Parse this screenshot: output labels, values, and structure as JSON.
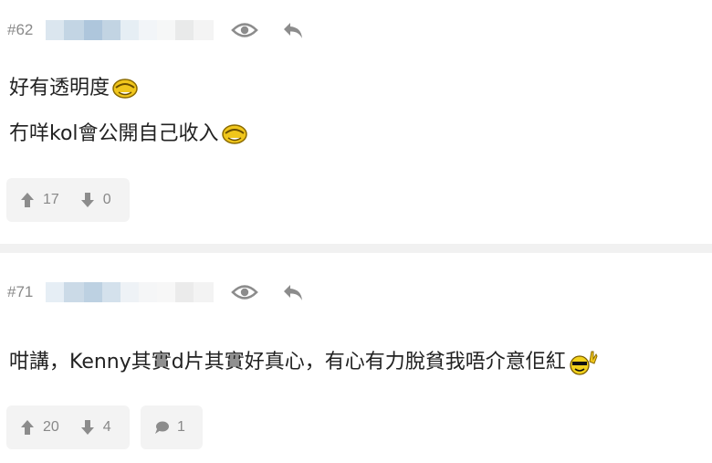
{
  "posts": [
    {
      "number": "#62",
      "lines": [
        "好有透明度",
        "冇咩kol會公開自己收入"
      ],
      "upvotes": "17",
      "downvotes": "0"
    },
    {
      "number": "#71",
      "lines": [
        "咁講，Kenny其實d片其實好真心，有心有力脫貧我唔介意佢紅"
      ],
      "upvotes": "20",
      "downvotes": "4",
      "replies": "1"
    }
  ],
  "colors": {
    "meta_gray": "#8a8a8a",
    "box_bg": "#f3f3f3",
    "separator": "#f1f1f1",
    "icon_gray": "#8c8c8c"
  },
  "icons": [
    "eye-icon",
    "reply-icon",
    "thumb-up-icon",
    "thumb-down-icon",
    "comment-icon",
    "emoji-icon"
  ]
}
